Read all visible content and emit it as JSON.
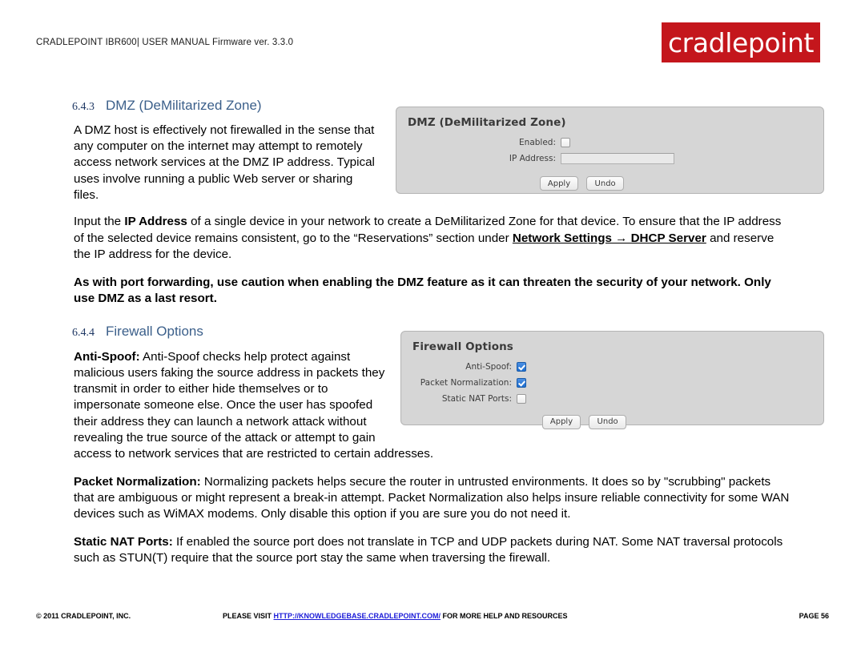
{
  "header": {
    "running_title": "CRADLEPOINT IBR600| USER MANUAL Firmware ver. 3.3.0",
    "logo_text": "cradlepoint",
    "logo_color": "#c4161c"
  },
  "sections": [
    {
      "number": "6.4.3",
      "title": "DMZ (DeMilitarized Zone)",
      "title_color": "#3b5f8a"
    },
    {
      "number": "6.4.4",
      "title": "Firewall Options",
      "title_color": "#3b5f8a"
    }
  ],
  "body": {
    "dmz_intro": "A DMZ host is effectively not firewalled in the sense that any computer on the internet may attempt to remotely access network services at the DMZ IP address. Typical uses involve running a public Web server or sharing files.",
    "dmz_ip_p1": "Input the ",
    "dmz_ip_bold1": "IP Address",
    "dmz_ip_p2": " of a single device in your network to create a DeMilitarized Zone for that device. To ensure that the IP address of the selected device remains consistent, go to the “Reservations” section under ",
    "dmz_ip_link": "Network Settings → DHCP Server",
    "dmz_ip_p3": " and reserve the IP address for the device.",
    "dmz_warning": "As with port forwarding, use caution when enabling the DMZ feature as it can threaten the security of your network. Only use DMZ as a last resort.",
    "antispoof_label": "Anti-Spoof:",
    "antispoof_text": " Anti-Spoof checks help protect against malicious users faking the source address in packets they transmit in order to either hide themselves or to impersonate someone else. Once the user has spoofed their address they can launch a network attack without revealing the true source of the attack or attempt to gain access to network services that are restricted to certain addresses.",
    "packetnorm_label": "Packet Normalization:",
    "packetnorm_text": " Normalizing packets helps secure the router in untrusted environments. It does so by \"scrubbing\" packets that are ambiguous or might represent a break-in attempt. Packet Normalization also helps insure reliable connectivity for some WAN devices such as WiMAX modems. Only disable this option if you are sure you do not need it.",
    "staticnat_label": "Static NAT Ports:",
    "staticnat_text": " If enabled the source port does not translate in TCP and UDP packets during NAT. Some NAT traversal protocols such as STUN(T) require that the source port stay the same when traversing the firewall."
  },
  "dmz_panel": {
    "title": "DMZ (DeMilitarized Zone)",
    "enabled_label": "Enabled:",
    "enabled_checked": false,
    "ip_label": "IP Address:",
    "ip_value": "",
    "apply_label": "Apply",
    "undo_label": "Undo"
  },
  "firewall_panel": {
    "title": "Firewall Options",
    "antispoof_label": "Anti-Spoof:",
    "antispoof_checked": true,
    "packetnorm_label": "Packet Normalization:",
    "packetnorm_checked": true,
    "staticnat_label": "Static NAT Ports:",
    "staticnat_checked": false,
    "apply_label": "Apply",
    "undo_label": "Undo"
  },
  "footer": {
    "copyright": "© 2011 CRADLEPOINT, INC.",
    "visit_prefix": "PLEASE VISIT ",
    "link_text": "HTTP://KNOWLEDGEBASE.CRADLEPOINT.COM/",
    "visit_suffix": " FOR MORE HELP AND RESOURCES",
    "page_label": "PAGE 56"
  }
}
